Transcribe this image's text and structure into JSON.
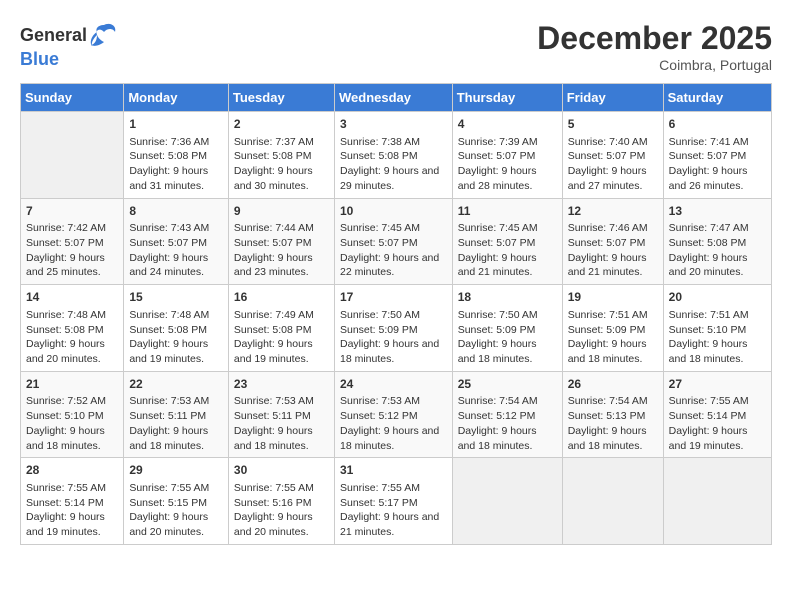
{
  "logo": {
    "general": "General",
    "blue": "Blue"
  },
  "title": "December 2025",
  "subtitle": "Coimbra, Portugal",
  "days_header": [
    "Sunday",
    "Monday",
    "Tuesday",
    "Wednesday",
    "Thursday",
    "Friday",
    "Saturday"
  ],
  "weeks": [
    [
      {
        "day": "",
        "sunrise": "",
        "sunset": "",
        "daylight": "",
        "empty": true
      },
      {
        "day": "1",
        "sunrise": "Sunrise: 7:36 AM",
        "sunset": "Sunset: 5:08 PM",
        "daylight": "Daylight: 9 hours and 31 minutes.",
        "empty": false
      },
      {
        "day": "2",
        "sunrise": "Sunrise: 7:37 AM",
        "sunset": "Sunset: 5:08 PM",
        "daylight": "Daylight: 9 hours and 30 minutes.",
        "empty": false
      },
      {
        "day": "3",
        "sunrise": "Sunrise: 7:38 AM",
        "sunset": "Sunset: 5:08 PM",
        "daylight": "Daylight: 9 hours and 29 minutes.",
        "empty": false
      },
      {
        "day": "4",
        "sunrise": "Sunrise: 7:39 AM",
        "sunset": "Sunset: 5:07 PM",
        "daylight": "Daylight: 9 hours and 28 minutes.",
        "empty": false
      },
      {
        "day": "5",
        "sunrise": "Sunrise: 7:40 AM",
        "sunset": "Sunset: 5:07 PM",
        "daylight": "Daylight: 9 hours and 27 minutes.",
        "empty": false
      },
      {
        "day": "6",
        "sunrise": "Sunrise: 7:41 AM",
        "sunset": "Sunset: 5:07 PM",
        "daylight": "Daylight: 9 hours and 26 minutes.",
        "empty": false
      }
    ],
    [
      {
        "day": "7",
        "sunrise": "Sunrise: 7:42 AM",
        "sunset": "Sunset: 5:07 PM",
        "daylight": "Daylight: 9 hours and 25 minutes.",
        "empty": false
      },
      {
        "day": "8",
        "sunrise": "Sunrise: 7:43 AM",
        "sunset": "Sunset: 5:07 PM",
        "daylight": "Daylight: 9 hours and 24 minutes.",
        "empty": false
      },
      {
        "day": "9",
        "sunrise": "Sunrise: 7:44 AM",
        "sunset": "Sunset: 5:07 PM",
        "daylight": "Daylight: 9 hours and 23 minutes.",
        "empty": false
      },
      {
        "day": "10",
        "sunrise": "Sunrise: 7:45 AM",
        "sunset": "Sunset: 5:07 PM",
        "daylight": "Daylight: 9 hours and 22 minutes.",
        "empty": false
      },
      {
        "day": "11",
        "sunrise": "Sunrise: 7:45 AM",
        "sunset": "Sunset: 5:07 PM",
        "daylight": "Daylight: 9 hours and 21 minutes.",
        "empty": false
      },
      {
        "day": "12",
        "sunrise": "Sunrise: 7:46 AM",
        "sunset": "Sunset: 5:07 PM",
        "daylight": "Daylight: 9 hours and 21 minutes.",
        "empty": false
      },
      {
        "day": "13",
        "sunrise": "Sunrise: 7:47 AM",
        "sunset": "Sunset: 5:08 PM",
        "daylight": "Daylight: 9 hours and 20 minutes.",
        "empty": false
      }
    ],
    [
      {
        "day": "14",
        "sunrise": "Sunrise: 7:48 AM",
        "sunset": "Sunset: 5:08 PM",
        "daylight": "Daylight: 9 hours and 20 minutes.",
        "empty": false
      },
      {
        "day": "15",
        "sunrise": "Sunrise: 7:48 AM",
        "sunset": "Sunset: 5:08 PM",
        "daylight": "Daylight: 9 hours and 19 minutes.",
        "empty": false
      },
      {
        "day": "16",
        "sunrise": "Sunrise: 7:49 AM",
        "sunset": "Sunset: 5:08 PM",
        "daylight": "Daylight: 9 hours and 19 minutes.",
        "empty": false
      },
      {
        "day": "17",
        "sunrise": "Sunrise: 7:50 AM",
        "sunset": "Sunset: 5:09 PM",
        "daylight": "Daylight: 9 hours and 18 minutes.",
        "empty": false
      },
      {
        "day": "18",
        "sunrise": "Sunrise: 7:50 AM",
        "sunset": "Sunset: 5:09 PM",
        "daylight": "Daylight: 9 hours and 18 minutes.",
        "empty": false
      },
      {
        "day": "19",
        "sunrise": "Sunrise: 7:51 AM",
        "sunset": "Sunset: 5:09 PM",
        "daylight": "Daylight: 9 hours and 18 minutes.",
        "empty": false
      },
      {
        "day": "20",
        "sunrise": "Sunrise: 7:51 AM",
        "sunset": "Sunset: 5:10 PM",
        "daylight": "Daylight: 9 hours and 18 minutes.",
        "empty": false
      }
    ],
    [
      {
        "day": "21",
        "sunrise": "Sunrise: 7:52 AM",
        "sunset": "Sunset: 5:10 PM",
        "daylight": "Daylight: 9 hours and 18 minutes.",
        "empty": false
      },
      {
        "day": "22",
        "sunrise": "Sunrise: 7:53 AM",
        "sunset": "Sunset: 5:11 PM",
        "daylight": "Daylight: 9 hours and 18 minutes.",
        "empty": false
      },
      {
        "day": "23",
        "sunrise": "Sunrise: 7:53 AM",
        "sunset": "Sunset: 5:11 PM",
        "daylight": "Daylight: 9 hours and 18 minutes.",
        "empty": false
      },
      {
        "day": "24",
        "sunrise": "Sunrise: 7:53 AM",
        "sunset": "Sunset: 5:12 PM",
        "daylight": "Daylight: 9 hours and 18 minutes.",
        "empty": false
      },
      {
        "day": "25",
        "sunrise": "Sunrise: 7:54 AM",
        "sunset": "Sunset: 5:12 PM",
        "daylight": "Daylight: 9 hours and 18 minutes.",
        "empty": false
      },
      {
        "day": "26",
        "sunrise": "Sunrise: 7:54 AM",
        "sunset": "Sunset: 5:13 PM",
        "daylight": "Daylight: 9 hours and 18 minutes.",
        "empty": false
      },
      {
        "day": "27",
        "sunrise": "Sunrise: 7:55 AM",
        "sunset": "Sunset: 5:14 PM",
        "daylight": "Daylight: 9 hours and 19 minutes.",
        "empty": false
      }
    ],
    [
      {
        "day": "28",
        "sunrise": "Sunrise: 7:55 AM",
        "sunset": "Sunset: 5:14 PM",
        "daylight": "Daylight: 9 hours and 19 minutes.",
        "empty": false
      },
      {
        "day": "29",
        "sunrise": "Sunrise: 7:55 AM",
        "sunset": "Sunset: 5:15 PM",
        "daylight": "Daylight: 9 hours and 20 minutes.",
        "empty": false
      },
      {
        "day": "30",
        "sunrise": "Sunrise: 7:55 AM",
        "sunset": "Sunset: 5:16 PM",
        "daylight": "Daylight: 9 hours and 20 minutes.",
        "empty": false
      },
      {
        "day": "31",
        "sunrise": "Sunrise: 7:55 AM",
        "sunset": "Sunset: 5:17 PM",
        "daylight": "Daylight: 9 hours and 21 minutes.",
        "empty": false
      },
      {
        "day": "",
        "sunrise": "",
        "sunset": "",
        "daylight": "",
        "empty": true
      },
      {
        "day": "",
        "sunrise": "",
        "sunset": "",
        "daylight": "",
        "empty": true
      },
      {
        "day": "",
        "sunrise": "",
        "sunset": "",
        "daylight": "",
        "empty": true
      }
    ]
  ]
}
